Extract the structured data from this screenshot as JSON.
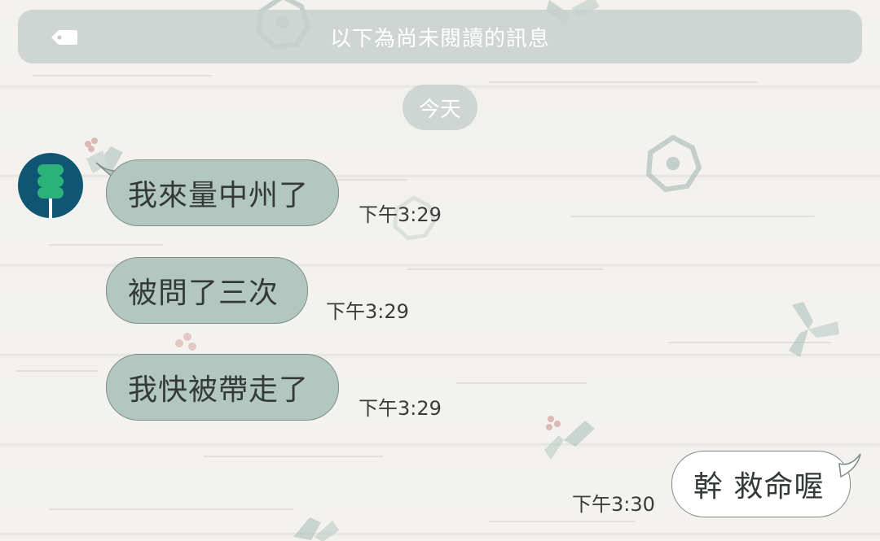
{
  "unread_banner": {
    "text": "以下為尚未閱讀的訊息",
    "icon": "tag-icon"
  },
  "date_divider": {
    "label": "今天"
  },
  "messages": [
    {
      "direction": "incoming",
      "text": "我來量中州了",
      "time": "下午3:29"
    },
    {
      "direction": "incoming",
      "text": "被問了三次",
      "time": "下午3:29"
    },
    {
      "direction": "incoming",
      "text": "我快被帶走了",
      "time": "下午3:29"
    },
    {
      "direction": "outgoing",
      "text": "幹 救命喔",
      "time": "下午3:30"
    }
  ],
  "colors": {
    "incoming_bubble": "#b3c7c1",
    "outgoing_bubble": "#ffffff",
    "banner": "#c8d0ce",
    "avatar_bg": "#0f5673",
    "avatar_figure": "#2bb27a"
  }
}
